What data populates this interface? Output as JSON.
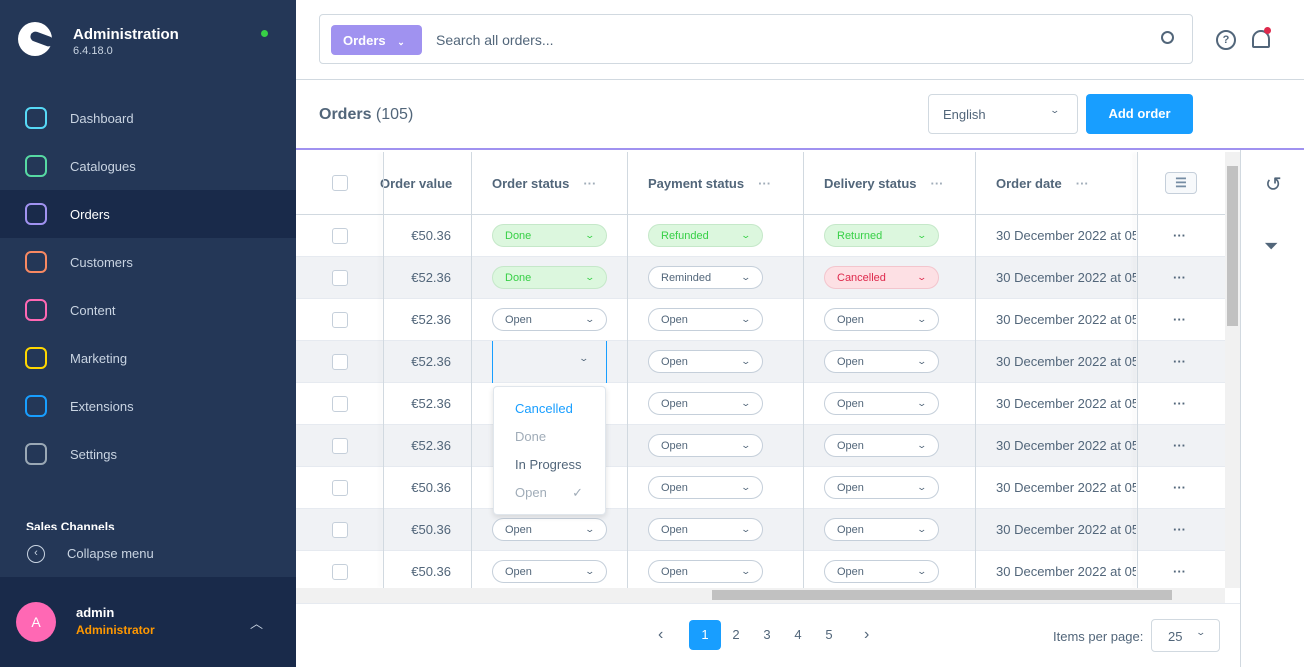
{
  "app": {
    "title": "Administration",
    "version": "6.4.18.0"
  },
  "nav": [
    {
      "label": "Dashboard",
      "icon": "gauge-icon",
      "color": "#57d9f6"
    },
    {
      "label": "Catalogues",
      "icon": "products-icon",
      "color": "#57d9a3"
    },
    {
      "label": "Orders",
      "icon": "bag-icon",
      "color": "#a092f0"
    },
    {
      "label": "Customers",
      "icon": "users-icon",
      "color": "#f88962"
    },
    {
      "label": "Content",
      "icon": "content-icon",
      "color": "#ff68b4"
    },
    {
      "label": "Marketing",
      "icon": "megaphone-icon",
      "color": "#ffd700"
    },
    {
      "label": "Extensions",
      "icon": "plug-icon",
      "color": "#189eff"
    },
    {
      "label": "Settings",
      "icon": "gear-icon",
      "color": "#9aa8b5"
    }
  ],
  "sales_channels": "Sales Channels",
  "collapse": "Collapse menu",
  "user": {
    "initial": "A",
    "name": "admin",
    "role": "Administrator"
  },
  "search": {
    "type": "Orders",
    "placeholder": "Search all orders..."
  },
  "header": {
    "title": "Orders",
    "count": "(105)",
    "language": "English",
    "add": "Add order"
  },
  "columns": [
    "Order value",
    "Order status",
    "Payment status",
    "Delivery status",
    "Order date"
  ],
  "rows": [
    {
      "value": "€50.36",
      "order": "Done",
      "payment": "Refunded",
      "delivery": "Returned",
      "date": "30 December 2022 at 05:"
    },
    {
      "value": "€52.36",
      "order": "Done",
      "payment": "Reminded",
      "delivery": "Cancelled",
      "date": "30 December 2022 at 05:"
    },
    {
      "value": "€52.36",
      "order": "Open",
      "payment": "Open",
      "delivery": "Open",
      "date": "30 December 2022 at 05:"
    },
    {
      "value": "€52.36",
      "order": "",
      "payment": "Open",
      "delivery": "Open",
      "date": "30 December 2022 at 05:"
    },
    {
      "value": "€52.36",
      "order": "",
      "payment": "Open",
      "delivery": "Open",
      "date": "30 December 2022 at 05:"
    },
    {
      "value": "€52.36",
      "order": "",
      "payment": "Open",
      "delivery": "Open",
      "date": "30 December 2022 at 05:"
    },
    {
      "value": "€50.36",
      "order": "",
      "payment": "Open",
      "delivery": "Open",
      "date": "30 December 2022 at 05:"
    },
    {
      "value": "€50.36",
      "order": "Open",
      "payment": "Open",
      "delivery": "Open",
      "date": "30 December 2022 at 05:"
    },
    {
      "value": "€50.36",
      "order": "Open",
      "payment": "Open",
      "delivery": "Open",
      "date": "30 December 2022 at 05:"
    }
  ],
  "dropdown": [
    {
      "label": "Cancelled",
      "state": "highlighted"
    },
    {
      "label": "Done",
      "state": "disabled"
    },
    {
      "label": "In Progress",
      "state": "normal"
    },
    {
      "label": "Open",
      "state": "selected"
    }
  ],
  "pagination": {
    "pages": [
      "1",
      "2",
      "3",
      "4",
      "5"
    ],
    "current": "1",
    "items_label": "Items per page:",
    "items": "25"
  }
}
